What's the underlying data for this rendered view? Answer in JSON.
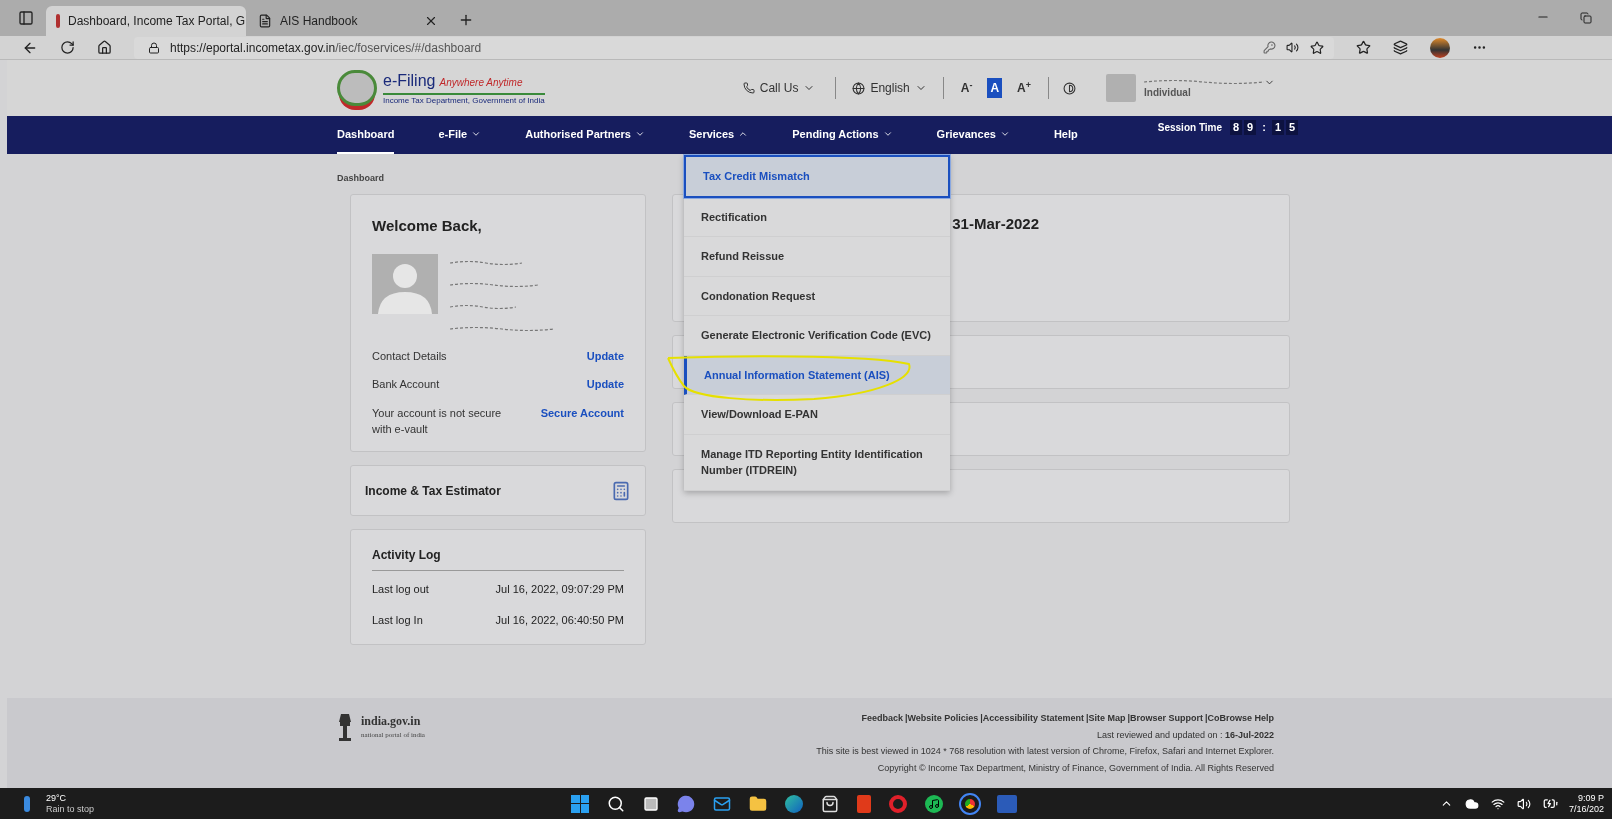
{
  "browser": {
    "tabs": [
      {
        "title": "Dashboard, Income Tax Portal, G",
        "selected": true
      },
      {
        "title": "AIS Handbook",
        "selected": false
      }
    ],
    "url_host": "https://eportal.incometax.gov.in",
    "url_path": "/iec/foservices/#/dashboard"
  },
  "header": {
    "logo_title": "e-Filing",
    "logo_tagline": "Anywhere Anytime",
    "logo_subtitle": "Income Tax Department, Government of India",
    "call_us": "Call Us",
    "language": "English",
    "font_controls": [
      {
        "label": "A$^{-}$",
        "selected": false
      },
      {
        "label": "A",
        "selected": true
      },
      {
        "label": "A$^{+}$",
        "selected": false
      }
    ],
    "user_role": "Individual"
  },
  "nav": {
    "items": [
      {
        "label": "Dashboard",
        "selected": true,
        "dropdown": false
      },
      {
        "label": "e-File",
        "selected": false,
        "dropdown": true
      },
      {
        "label": "Authorised Partners",
        "selected": false,
        "dropdown": true
      },
      {
        "label": "Services",
        "selected": false,
        "dropdown": true,
        "expanded": true
      },
      {
        "label": "Pending Actions",
        "selected": false,
        "dropdown": true
      },
      {
        "label": "Grievances",
        "selected": false,
        "dropdown": true
      },
      {
        "label": "Help",
        "selected": false,
        "dropdown": false
      }
    ],
    "session_label": "Session Time",
    "session_digits": [
      "8",
      "9",
      ":",
      "1",
      "5"
    ]
  },
  "services_menu": [
    {
      "label": "Tax Credit Mismatch",
      "focused": true,
      "highlighted": false
    },
    {
      "label": "Rectification",
      "focused": false,
      "highlighted": false
    },
    {
      "label": "Refund Reissue",
      "focused": false,
      "highlighted": false
    },
    {
      "label": "Condonation Request",
      "focused": false,
      "highlighted": false
    },
    {
      "label": "Generate Electronic Verification Code (EVC)",
      "focused": false,
      "highlighted": false
    },
    {
      "label": "Annual Information Statement (AIS)",
      "focused": false,
      "highlighted": true
    },
    {
      "label": "View/Download E-PAN",
      "focused": false,
      "highlighted": false
    },
    {
      "label": "Manage ITD Reporting Entity Identification Number (ITDREIN)",
      "focused": false,
      "highlighted": false
    }
  ],
  "breadcrumb": "Dashboard",
  "profile_card": {
    "greeting": "Welcome Back,",
    "rows": [
      {
        "label": "Contact Details",
        "action": "Update"
      },
      {
        "label": "Bank Account",
        "action": "Update"
      },
      {
        "label": "Your account is not secure with e-vault",
        "action": "Secure Account"
      }
    ]
  },
  "estimator_card": {
    "title": "Income & Tax Estimator"
  },
  "activity_log": {
    "title": "Activity Log",
    "rows": [
      {
        "label": "Last log out",
        "value": "Jul 16, 2022, 09:07:29 PM"
      },
      {
        "label": "Last log In",
        "value": "Jul 16, 2022, 06:40:50 PM"
      }
    ]
  },
  "summary_card": {
    "text": "31-Mar-2022"
  },
  "footer": {
    "logo_title": "india.gov.in",
    "logo_subtitle": "national portal of india",
    "links": [
      "Feedback",
      "|Website Policies",
      "|Accessibility Statement",
      "|Site Map",
      "|Browser Support",
      "|CoBrowse Help"
    ],
    "reviewed": "Last reviewed and updated on : **16-Jul-2022**",
    "best_viewed": "This site is best viewed in 1024 * 768 resolution with latest version of Chrome, Firefox, Safari and Internet Explorer.",
    "copyright": "Copyright © Income Tax Department, Ministry of Finance, Government of India. All Rights Reserved"
  },
  "taskbar": {
    "temperature": "29°C",
    "weather": "Rain to stop",
    "time": "9:09 P",
    "date": "7/16/202"
  }
}
